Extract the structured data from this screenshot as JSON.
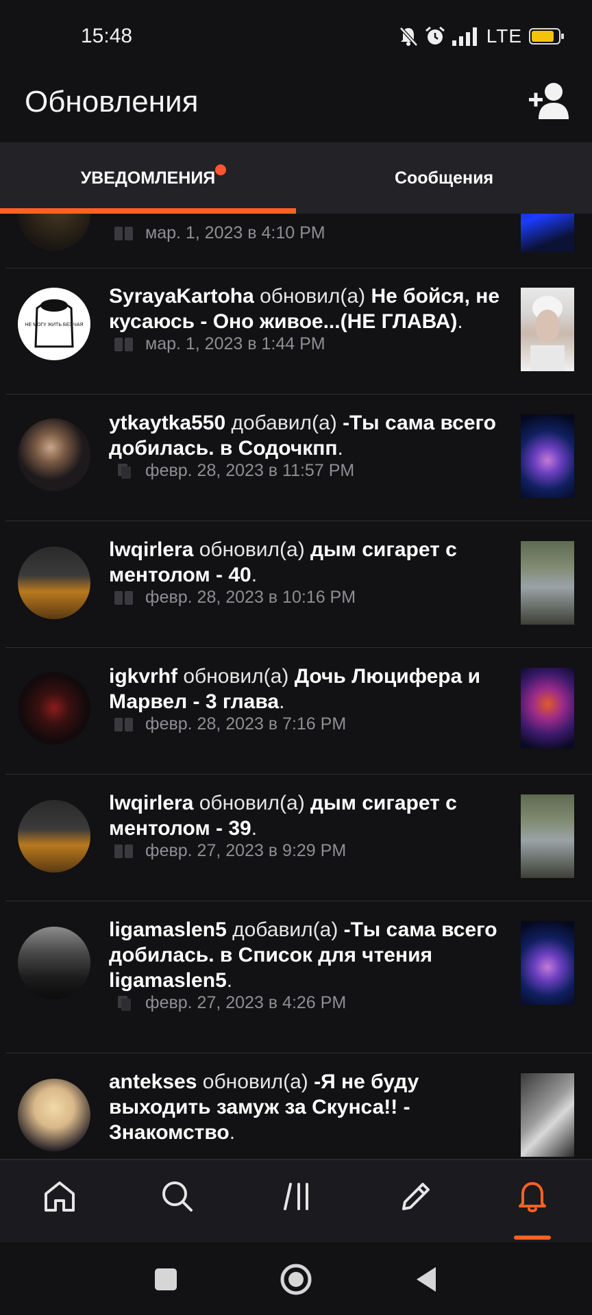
{
  "status_bar": {
    "time": "15:48",
    "network": "LTE",
    "battery": "80"
  },
  "header": {
    "title": "Обновления"
  },
  "tabs": [
    {
      "label": "УВЕДОМЛЕНИЯ",
      "active": true,
      "has_dot": true
    },
    {
      "label": "Сообщения",
      "active": false,
      "has_dot": false
    }
  ],
  "notifications": [
    {
      "user": "",
      "action": "",
      "story": "",
      "suffix": "",
      "timestamp": "мар. 1, 2023 в 4:10 PM",
      "meta_icon": "book-icon"
    },
    {
      "user": "SyrayaKartoha",
      "action": " обновил(а) ",
      "story": "Не бойся, не кусаюсь - Оно живое...(НЕ ГЛАВА)",
      "suffix": ".",
      "timestamp": "мар. 1, 2023 в 1:44 PM",
      "meta_icon": "book-icon",
      "avatar_text": "НЕ МОГУ ЖИТЬ БЕЗ ЧАЯ"
    },
    {
      "user": "ytkaytka550",
      "action": " добавил(а) ",
      "story": "-Ты сама всего добилась. в Содочкпп",
      "suffix": ".",
      "timestamp": "февр. 28, 2023 в 11:57 PM",
      "meta_icon": "reading-list-icon"
    },
    {
      "user": "lwqirlera",
      "action": " обновил(а) ",
      "story": "дым сигарет с ментолом - 40",
      "suffix": ".",
      "timestamp": "февр. 28, 2023 в 10:16 PM",
      "meta_icon": "book-icon"
    },
    {
      "user": "igkvrhf",
      "action": " обновил(а) ",
      "story": "Дочь Люцифера и Марвел - 3 глава",
      "suffix": ".",
      "timestamp": "февр. 28, 2023 в 7:16 PM",
      "meta_icon": "book-icon"
    },
    {
      "user": "lwqirlera",
      "action": " обновил(а) ",
      "story": "дым сигарет с ментолом - 39",
      "suffix": ".",
      "timestamp": "февр. 27, 2023 в 9:29 PM",
      "meta_icon": "book-icon"
    },
    {
      "user": "ligamaslen5",
      "action": " добавил(а) ",
      "story": "-Ты сама всего добилась. в Список для чтения ligamaslen5",
      "suffix": ".",
      "timestamp": "февр. 27, 2023 в 4:26 PM",
      "meta_icon": "reading-list-icon"
    },
    {
      "user": "antekses",
      "action": " обновил(а) ",
      "story": "-Я не буду выходить замуж за Скунса!! - Знакомство",
      "suffix": ".",
      "timestamp": "",
      "meta_icon": "book-icon"
    }
  ],
  "bottom_nav": [
    {
      "icon": "home-icon",
      "active": false
    },
    {
      "icon": "search-icon",
      "active": false
    },
    {
      "icon": "library-icon",
      "active": false
    },
    {
      "icon": "write-icon",
      "active": false
    },
    {
      "icon": "bell-icon",
      "active": true
    }
  ],
  "colors": {
    "accent": "#ff6122",
    "background": "#121113",
    "tab_bar": "#232226",
    "nav_bar": "#1b1a1e",
    "meta_text": "#8f8e93"
  }
}
